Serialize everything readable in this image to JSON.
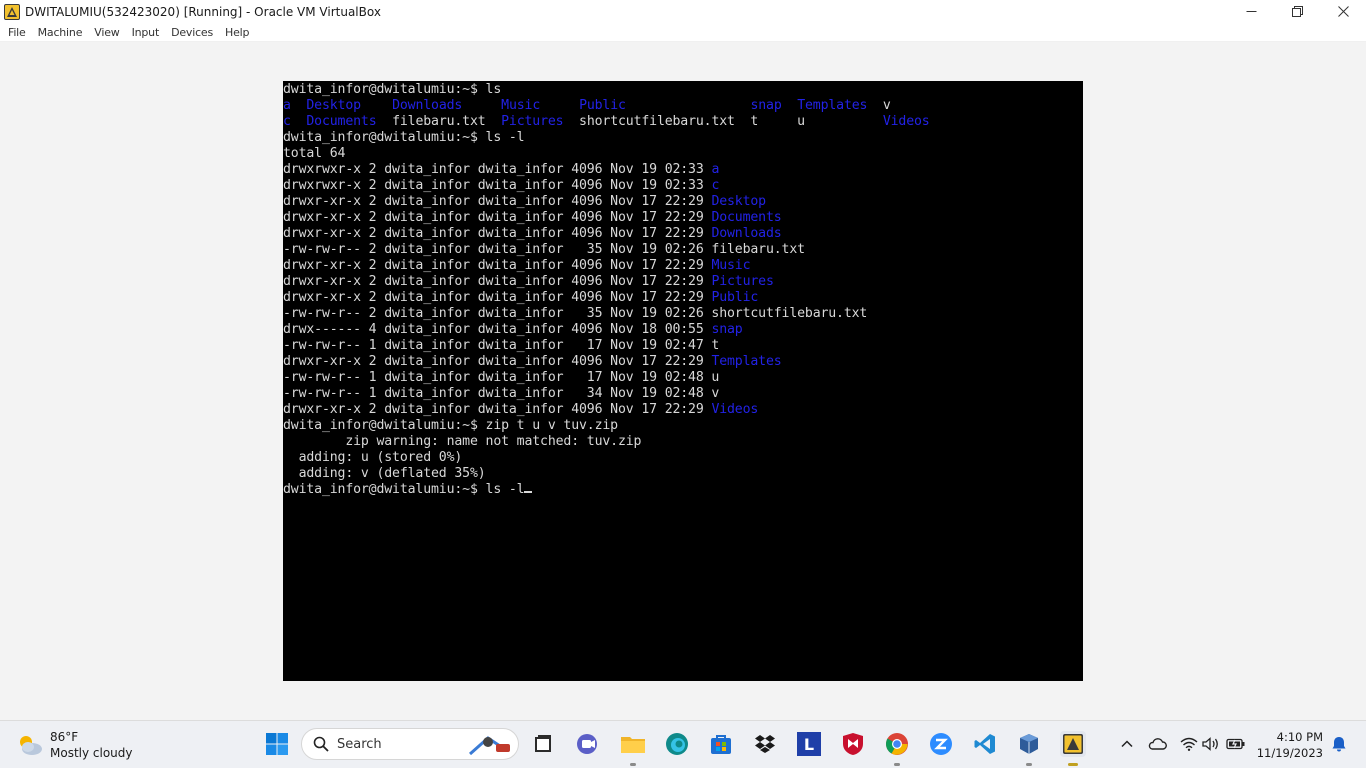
{
  "window": {
    "title": "DWITALUMIU(532423020) [Running] - Oracle VM VirtualBox"
  },
  "menu": [
    "File",
    "Machine",
    "View",
    "Input",
    "Devices",
    "Help"
  ],
  "terminal": {
    "lines": [
      [
        {
          "t": "dwita_infor@dwitalumiu:~$ ls"
        }
      ],
      [
        {
          "t": "a",
          "c": "dir"
        },
        {
          "t": "  "
        },
        {
          "t": "Desktop",
          "c": "dir"
        },
        {
          "t": "    "
        },
        {
          "t": "Downloads",
          "c": "dir"
        },
        {
          "t": "     "
        },
        {
          "t": "Music",
          "c": "dir"
        },
        {
          "t": "     "
        },
        {
          "t": "Public",
          "c": "dir"
        },
        {
          "t": "                "
        },
        {
          "t": "snap",
          "c": "dir"
        },
        {
          "t": "  "
        },
        {
          "t": "Templates",
          "c": "dir"
        },
        {
          "t": "  v"
        }
      ],
      [
        {
          "t": "c",
          "c": "dir"
        },
        {
          "t": "  "
        },
        {
          "t": "Documents",
          "c": "dir"
        },
        {
          "t": "  filebaru.txt  "
        },
        {
          "t": "Pictures",
          "c": "dir"
        },
        {
          "t": "  shortcutfilebaru.txt  t     u          "
        },
        {
          "t": "Videos",
          "c": "dir"
        }
      ],
      [
        {
          "t": "dwita_infor@dwitalumiu:~$ ls -l"
        }
      ],
      [
        {
          "t": "total 64"
        }
      ],
      [
        {
          "t": "drwxrwxr-x 2 dwita_infor dwita_infor 4096 Nov 19 02:33 "
        },
        {
          "t": "a",
          "c": "dir"
        }
      ],
      [
        {
          "t": "drwxrwxr-x 2 dwita_infor dwita_infor 4096 Nov 19 02:33 "
        },
        {
          "t": "c",
          "c": "dir"
        }
      ],
      [
        {
          "t": "drwxr-xr-x 2 dwita_infor dwita_infor 4096 Nov 17 22:29 "
        },
        {
          "t": "Desktop",
          "c": "dir"
        }
      ],
      [
        {
          "t": "drwxr-xr-x 2 dwita_infor dwita_infor 4096 Nov 17 22:29 "
        },
        {
          "t": "Documents",
          "c": "dir"
        }
      ],
      [
        {
          "t": "drwxr-xr-x 2 dwita_infor dwita_infor 4096 Nov 17 22:29 "
        },
        {
          "t": "Downloads",
          "c": "dir"
        }
      ],
      [
        {
          "t": "-rw-rw-r-- 2 dwita_infor dwita_infor   35 Nov 19 02:26 filebaru.txt"
        }
      ],
      [
        {
          "t": "drwxr-xr-x 2 dwita_infor dwita_infor 4096 Nov 17 22:29 "
        },
        {
          "t": "Music",
          "c": "dir"
        }
      ],
      [
        {
          "t": "drwxr-xr-x 2 dwita_infor dwita_infor 4096 Nov 17 22:29 "
        },
        {
          "t": "Pictures",
          "c": "dir"
        }
      ],
      [
        {
          "t": "drwxr-xr-x 2 dwita_infor dwita_infor 4096 Nov 17 22:29 "
        },
        {
          "t": "Public",
          "c": "dir"
        }
      ],
      [
        {
          "t": "-rw-rw-r-- 2 dwita_infor dwita_infor   35 Nov 19 02:26 shortcutfilebaru.txt"
        }
      ],
      [
        {
          "t": "drwx------ 4 dwita_infor dwita_infor 4096 Nov 18 00:55 "
        },
        {
          "t": "snap",
          "c": "dir"
        }
      ],
      [
        {
          "t": "-rw-rw-r-- 1 dwita_infor dwita_infor   17 Nov 19 02:47 t"
        }
      ],
      [
        {
          "t": "drwxr-xr-x 2 dwita_infor dwita_infor 4096 Nov 17 22:29 "
        },
        {
          "t": "Templates",
          "c": "dir"
        }
      ],
      [
        {
          "t": "-rw-rw-r-- 1 dwita_infor dwita_infor   17 Nov 19 02:48 u"
        }
      ],
      [
        {
          "t": "-rw-rw-r-- 1 dwita_infor dwita_infor   34 Nov 19 02:48 v"
        }
      ],
      [
        {
          "t": "drwxr-xr-x 2 dwita_infor dwita_infor 4096 Nov 17 22:29 "
        },
        {
          "t": "Videos",
          "c": "dir"
        }
      ],
      [
        {
          "t": "dwita_infor@dwitalumiu:~$ zip t u v tuv.zip"
        }
      ],
      [
        {
          "t": "        zip warning: name not matched: tuv.zip"
        }
      ],
      [
        {
          "t": "  adding: u (stored 0%)"
        }
      ],
      [
        {
          "t": "  adding: v (deflated 35%)"
        }
      ],
      [
        {
          "t": "dwita_infor@dwitalumiu:~$ ls -l"
        }
      ]
    ]
  },
  "taskbar": {
    "weather": {
      "temp": "86°F",
      "condition": "Mostly cloudy"
    },
    "search_label": "Search",
    "clock": {
      "time": "4:10 PM",
      "date": "11/19/2023"
    },
    "pinned_letter_l": "L"
  },
  "colors": {
    "terminal_bg": "#000000",
    "terminal_fg": "#d8d8d8",
    "dir_blue": "#2222e6"
  }
}
